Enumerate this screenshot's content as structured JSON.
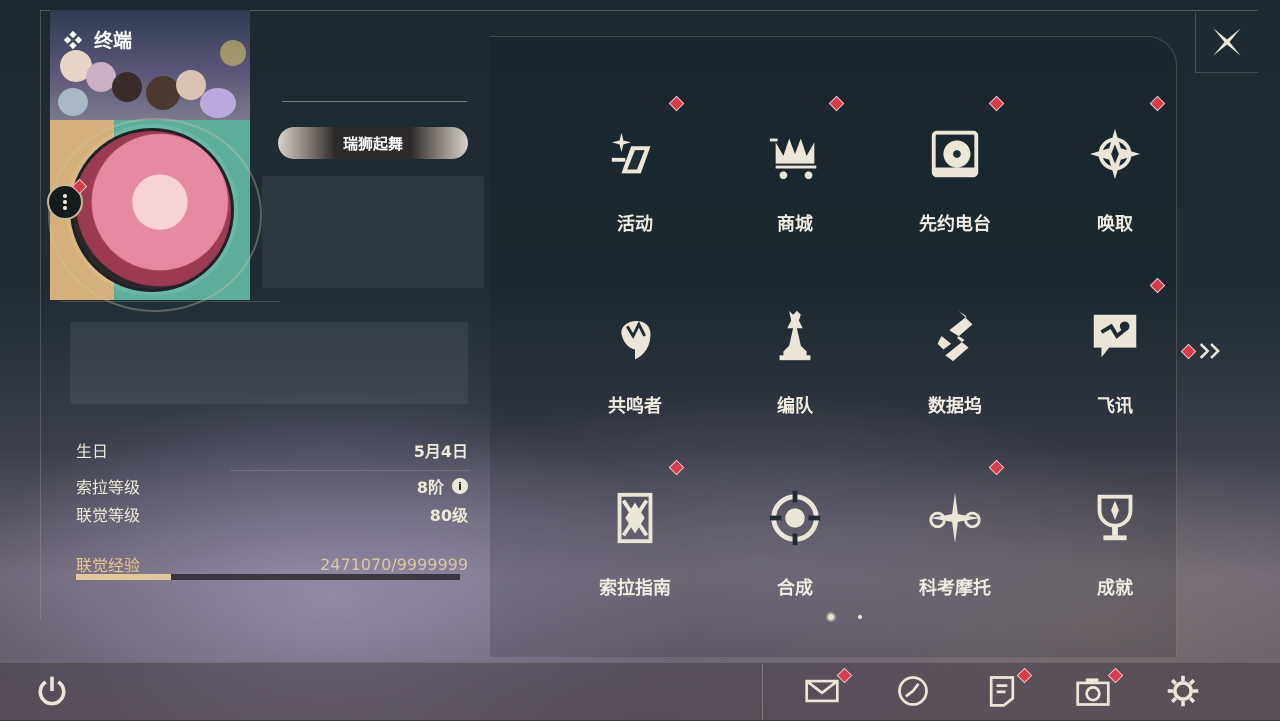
{
  "terminal": {
    "title": "终端",
    "icon": "diamond-cluster-icon"
  },
  "profile": {
    "nameplate": "瑞狮起舞",
    "birthday_label": "生日",
    "birthday_value": "5月4日",
    "sola_level_label": "索拉等级",
    "sola_level_value": "8阶",
    "union_level_label": "联觉等级",
    "union_level_value": "80级",
    "union_exp_label": "联觉经验",
    "union_exp_value": "2471070/9999999",
    "union_exp_fraction": 0.2471
  },
  "menu": {
    "items": [
      {
        "label": "活动",
        "icon": "sparkle-slash-icon",
        "notify": true
      },
      {
        "label": "商城",
        "icon": "crown-cart-icon",
        "notify": true
      },
      {
        "label": "先约电台",
        "icon": "turntable-icon",
        "notify": true
      },
      {
        "label": "唤取",
        "icon": "compass-star-icon",
        "notify": true
      },
      {
        "label": "共鸣者",
        "icon": "character-head-icon",
        "notify": false
      },
      {
        "label": "编队",
        "icon": "chess-pieces-icon",
        "notify": false
      },
      {
        "label": "数据坞",
        "icon": "data-dock-icon",
        "notify": false
      },
      {
        "label": "飞讯",
        "icon": "chat-bubble-icon",
        "notify": true
      },
      {
        "label": "索拉指南",
        "icon": "guide-book-icon",
        "notify": true
      },
      {
        "label": "合成",
        "icon": "synthesis-orb-icon",
        "notify": false
      },
      {
        "label": "科考摩托",
        "icon": "motorbike-icon",
        "notify": true
      },
      {
        "label": "成就",
        "icon": "trophy-icon",
        "notify": false
      }
    ],
    "next_page_icon": "double-chevron-right-icon",
    "page_count": 2,
    "current_page": 1
  },
  "bottom": {
    "buttons": [
      "power-icon",
      "mail-icon",
      "clock-icon",
      "notice-icon",
      "camera-icon",
      "settings-gear-icon"
    ]
  },
  "colors": {
    "accent": "#d43c4a",
    "gold": "#e0c9a0",
    "text": "#f1ece1"
  }
}
